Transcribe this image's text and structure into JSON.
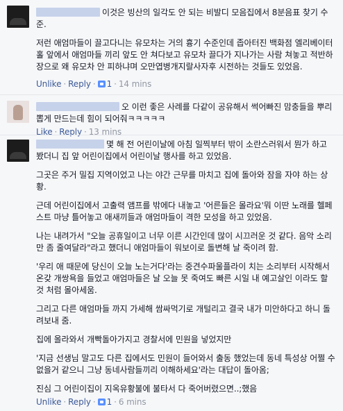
{
  "comments": [
    {
      "lines": [
        "이것은 빙산의 일각도 안 되는 비발디 모음집에서 8분음표 찾기 수준.",
        "저런 애엄마들이 끌고다니는 유모차는 거의 흉기 수준인데 좁아터진 백화점 엘리베이터 홀 앞에서 애엄마들 끼리 앞도 안 쳐다보고 유모차 끌다가 지나가는 사람 쳐놓고 적반하장으로 왜 유모차 안 피하냐며 오만엽병개지랄사자후 시전하는 것들도 있었음."
      ],
      "actions": {
        "unlike": "Unlike",
        "reply": "Reply",
        "likes": "1",
        "time": "14 mins"
      }
    },
    {
      "lines": [
        "오 이런 좋은 사례를 다같이 공유해서 썩어빠진 맘충들을 뿌리뽑게 만드는데 힘이 되어줘ㅋㅋㅋㅋㅋ"
      ],
      "actions": {
        "like": "Like",
        "reply": "Reply",
        "time": "13 mins"
      }
    },
    {
      "paragraphs": [
        "몇 해 전 어린이날에 아침 일찍부터 밖이 소란스러워서 뭔가 하고 봤더니 집 앞 어린이집에서 어린이날 행사를 하고 있었음.",
        "그곳은 주거 밀집 지역이었고 나는 야간 근무를 마치고 집에 돌아와 잠을 자야 하는 상황.",
        "근데 어린이집에서 고출력 앰프를 밖에다 내놓고 '어른들은 몰라요'뭐 이딴 노래를 헬페스트 마냥 틀어놓고 애새끼들과 애엄마들이 격한 모성을 하고 있었음.",
        "나는 내려가서 \"오늘 공휴일이고 너무 이른 시간인데 많이 시끄러운 것 같다. 음악 소리만 좀 줄여달라\"라고 했더니 애엄마들이 워보이로 돌변해 날 죽이려 함.",
        "'우리 애 때문에 당신이 오늘 노는거다'라는 중견수파울플라이 치는 소리부터 시작해서 온갖 개쌍욕을 들었고 애엄마들은 날 오늘 못 죽여도 빠른 시일 내 예고살인 이라도 할 것 처럼 몰아세움.",
        "그리고 다른 애엄마들 까지 가세해 쌈싸먹기로 개털리고 결국 내가 미안하다고 하니 돌려보내 줌.",
        "집에 올라와서 개빡돌아가지고 경찰서에 민원을 넣었지만",
        "'지금 선생님 말고도 다른 집에서도 민원이 들어와서 출동 했었는데 동네 특성상 어쩔 수 없을거 같으니 그냥 동네사람들끼리 이해하세요'라는 대답이 돌아옴;",
        "진심 그 어린이집이 지옥유황불에 불타서 다 죽어버렸으면..;했음"
      ],
      "actions": {
        "unlike": "Unlike",
        "reply": "Reply",
        "likes": "1",
        "time": "6 mins"
      }
    }
  ]
}
